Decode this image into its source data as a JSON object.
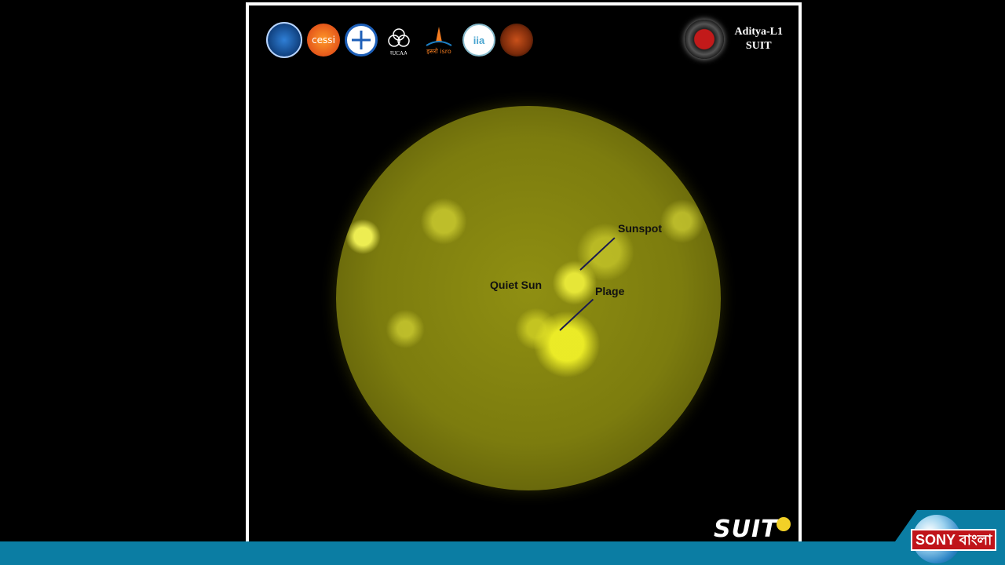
{
  "header": {
    "instrument_title": "Aditya-L1",
    "instrument_subtitle": "SUIT",
    "partner_logos": [
      "isro-institute-logo",
      "cessi-logo",
      "ncra-logo",
      "iucaa-logo",
      "isro-logo",
      "iia-logo",
      "university-emblem-logo"
    ],
    "partner_logo_texts": [
      "cessi",
      "IUCAA",
      "इसरो isro",
      "iia"
    ]
  },
  "image": {
    "labels": {
      "sunspot": "Sunspot",
      "quiet_sun": "Quiet Sun",
      "plage": "Plage"
    }
  },
  "footer": {
    "watermark": "SUIT",
    "channel_name": "SONY বাংলা"
  },
  "colors": {
    "sun": "#8f8f12",
    "ticker": "#0b7da3",
    "channel_red": "#c0141a"
  }
}
